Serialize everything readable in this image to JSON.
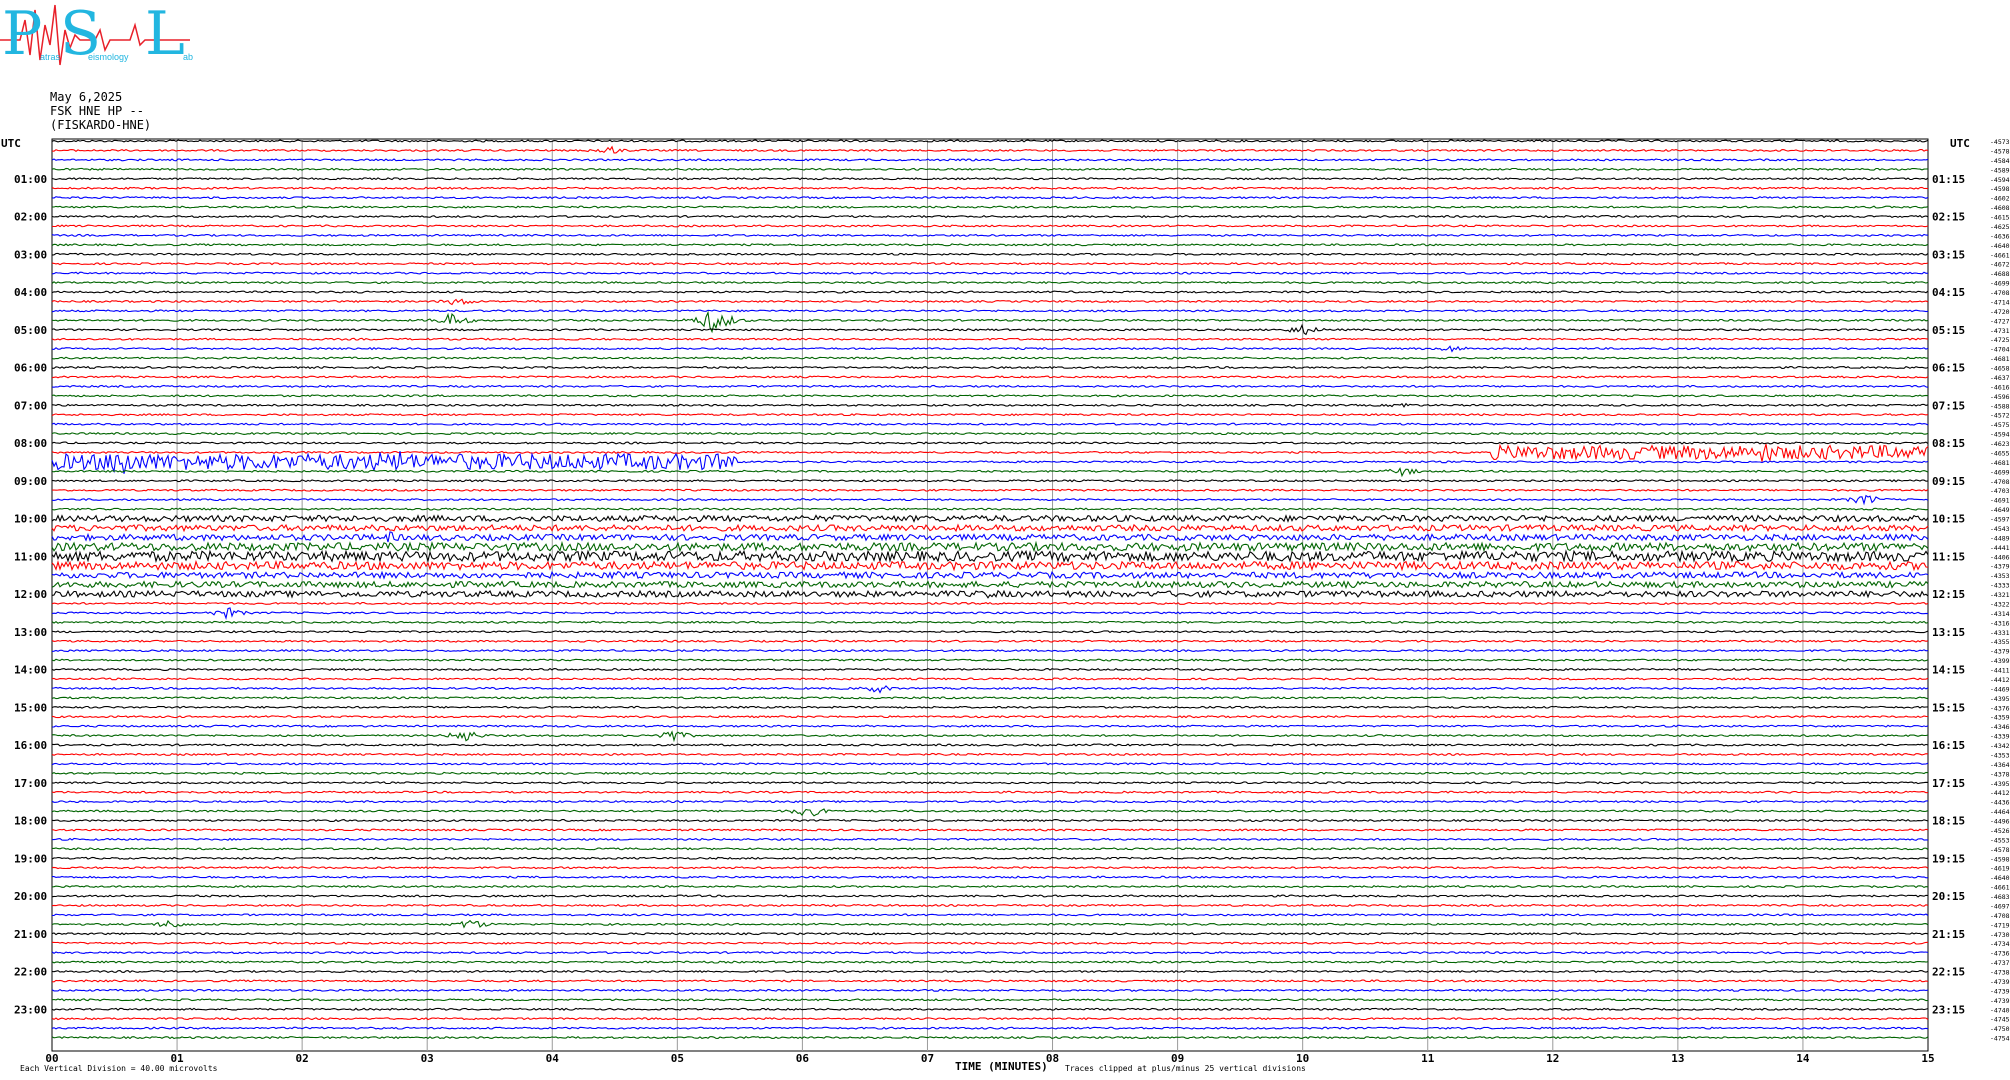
{
  "logo": {
    "letters": [
      "P",
      "S",
      "L"
    ],
    "small_words": [
      "atras",
      "eismology",
      "ab"
    ],
    "color": "#22b6e0",
    "spike_color": "#e8202a"
  },
  "header": {
    "date": "May 6,2025",
    "station": "FSK HNE HP --",
    "site": "(FISKARDO-HNE)"
  },
  "footer": {
    "scale_text": "Each Vertical Division =    40.00 microvolts",
    "clip_text": "Traces clipped at plus/minus 25 vertical divisions",
    "xlabel": "TIME (MINUTES)"
  },
  "chart_data": {
    "type": "line",
    "title": "",
    "xlabel": "TIME (MINUTES)",
    "ylabel": "",
    "xlim": [
      0,
      15
    ],
    "x_ticks": [
      "00",
      "01",
      "02",
      "03",
      "04",
      "05",
      "06",
      "07",
      "08",
      "09",
      "10",
      "11",
      "12",
      "13",
      "14",
      "15"
    ],
    "left_axis_title": "UTC",
    "right_axis_title": "UTC",
    "left_labels": [
      "01:00",
      "02:00",
      "03:00",
      "04:00",
      "05:00",
      "06:00",
      "07:00",
      "08:00",
      "09:00",
      "10:00",
      "11:00",
      "12:00",
      "13:00",
      "14:00",
      "15:00",
      "16:00",
      "17:00",
      "18:00",
      "19:00",
      "20:00",
      "21:00",
      "22:00",
      "23:00"
    ],
    "right_labels": [
      "01:15",
      "02:15",
      "03:15",
      "04:15",
      "05:15",
      "06:15",
      "07:15",
      "08:15",
      "09:15",
      "10:15",
      "11:15",
      "12:15",
      "13:15",
      "14:15",
      "15:15",
      "16:15",
      "17:15",
      "18:15",
      "19:15",
      "20:15",
      "21:15",
      "22:15",
      "23:15"
    ],
    "trace_colors": [
      "#000000",
      "#ff0000",
      "#0000ff",
      "#006400"
    ],
    "grid": true,
    "trace_count": 96,
    "trace_offsets": [
      "-4573",
      "-4578",
      "-4584",
      "-4589",
      "-4594",
      "-4598",
      "-4602",
      "-4608",
      "-4615",
      "-4625",
      "-4636",
      "-4640",
      "-4661",
      "-4672",
      "-4688",
      "-4699",
      "-4708",
      "-4714",
      "-4720",
      "-4727",
      "-4731",
      "-4725",
      "-4704",
      "-4681",
      "-4658",
      "-4637",
      "-4616",
      "-4596",
      "-4588",
      "-4572",
      "-4575",
      "-4594",
      "-4623",
      "-4655",
      "-4681",
      "-4699",
      "-4708",
      "-4703",
      "-4691",
      "-4649",
      "-4597",
      "-4543",
      "-4489",
      "-4441",
      "-4406",
      "-4379",
      "-4353",
      "-4333",
      "-4321",
      "-4322",
      "-4314",
      "-4316",
      "-4331",
      "-4355",
      "-4379",
      "-4399",
      "-4411",
      "-4412",
      "-4469",
      "-4395",
      "-4376",
      "-4359",
      "-4346",
      "-4339",
      "-4342",
      "-4353",
      "-4364",
      "-4378",
      "-4395",
      "-4412",
      "-4436",
      "-4464",
      "-4496",
      "-4526",
      "-4553",
      "-4578",
      "-4598",
      "-4619",
      "-4640",
      "-4661",
      "-4683",
      "-4697",
      "-4708",
      "-4719",
      "-4730",
      "-4734",
      "-4736",
      "-4737",
      "-4738",
      "-4739",
      "-4739",
      "-4739",
      "-4740",
      "-4745",
      "-4750",
      "-4754"
    ],
    "events": [
      {
        "trace": 1,
        "x": 4.45,
        "amp": 5
      },
      {
        "trace": 17,
        "x": 3.25,
        "amp": 5
      },
      {
        "trace": 19,
        "x": 3.2,
        "amp": 8
      },
      {
        "trace": 19,
        "x": 5.3,
        "amp": 14
      },
      {
        "trace": 20,
        "x": 10.0,
        "amp": 6
      },
      {
        "trace": 22,
        "x": 11.2,
        "amp": 4
      },
      {
        "trace": 28,
        "x": 10.8,
        "amp": 3
      },
      {
        "trace": 33,
        "x": 13.7,
        "amp": 12
      },
      {
        "trace": 34,
        "x": 0.55,
        "amp": 22
      },
      {
        "trace": 34,
        "x": 2.6,
        "amp": 12
      },
      {
        "trace": 34,
        "x": 2.8,
        "amp": 16
      },
      {
        "trace": 35,
        "x": 10.8,
        "amp": 5
      },
      {
        "trace": 38,
        "x": 14.5,
        "amp": 6
      },
      {
        "trace": 42,
        "x": 2.7,
        "amp": 6
      },
      {
        "trace": 44,
        "x": 11.0,
        "amp": 7
      },
      {
        "trace": 46,
        "x": 4.5,
        "amp": 5
      },
      {
        "trace": 48,
        "x": 7.5,
        "amp": 6
      },
      {
        "trace": 50,
        "x": 1.4,
        "amp": 6
      },
      {
        "trace": 58,
        "x": 6.6,
        "amp": 5
      },
      {
        "trace": 63,
        "x": 3.3,
        "amp": 7
      },
      {
        "trace": 63,
        "x": 4.95,
        "amp": 7
      },
      {
        "trace": 71,
        "x": 6.05,
        "amp": 7
      },
      {
        "trace": 83,
        "x": 3.35,
        "amp": 6
      },
      {
        "trace": 83,
        "x": 0.95,
        "amp": 5
      }
    ],
    "noisy_segments": [
      {
        "trace": 34,
        "x_start": 0.0,
        "x_end": 5.5,
        "amp": 8
      },
      {
        "trace": 33,
        "x_start": 11.5,
        "x_end": 15.0,
        "amp": 7
      },
      {
        "trace": 43,
        "x_start": 0.0,
        "x_end": 15.0,
        "amp": 4
      },
      {
        "trace": 44,
        "x_start": 0.0,
        "x_end": 15.0,
        "amp": 5
      },
      {
        "trace": 45,
        "x_start": 0.0,
        "x_end": 15.0,
        "amp": 4
      },
      {
        "trace": 42,
        "x_start": 0.0,
        "x_end": 15.0,
        "amp": 3
      },
      {
        "trace": 41,
        "x_start": 0.0,
        "x_end": 15.0,
        "amp": 3
      },
      {
        "trace": 40,
        "x_start": 0.0,
        "x_end": 15.0,
        "amp": 3
      },
      {
        "trace": 46,
        "x_start": 0.0,
        "x_end": 15.0,
        "amp": 3
      },
      {
        "trace": 47,
        "x_start": 0.0,
        "x_end": 15.0,
        "amp": 3
      },
      {
        "trace": 48,
        "x_start": 0.0,
        "x_end": 15.0,
        "amp": 3
      }
    ]
  }
}
